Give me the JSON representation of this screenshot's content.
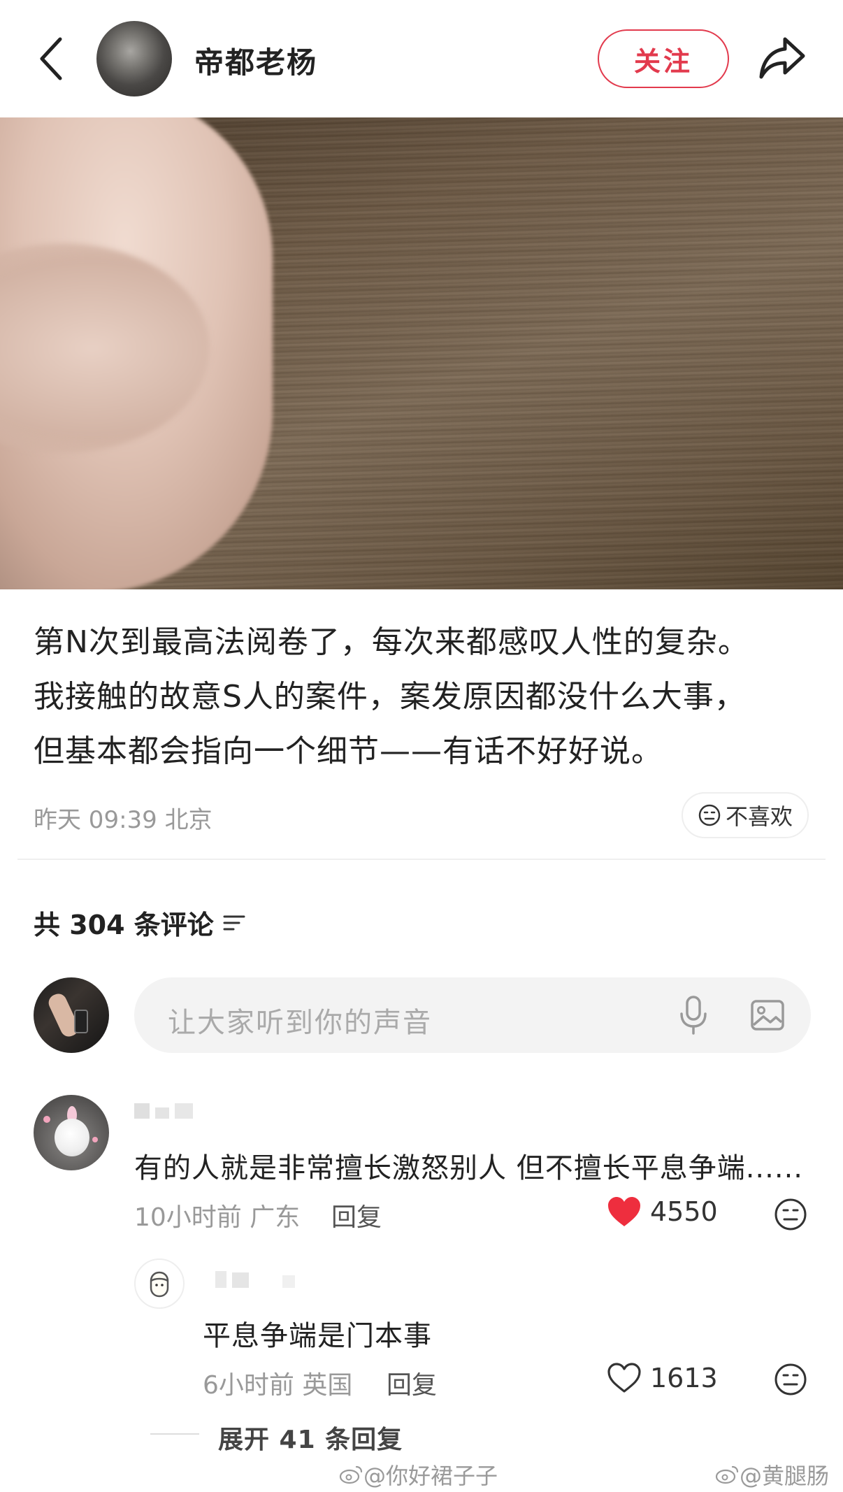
{
  "header": {
    "author_name": "帝都老杨",
    "follow_label": "关注"
  },
  "post": {
    "text_lines": [
      "第N次到最高法阅卷了，每次来都感叹人性的复杂。",
      "我接触的故意S人的案件，案发原因都没什么大事，",
      "但基本都会指向一个细节——有话不好好说。"
    ],
    "meta": "昨天 09:39 北京",
    "dislike_label": "不喜欢"
  },
  "comments_section": {
    "count_label": "共 304 条评论",
    "input_placeholder": "让大家听到你的声音"
  },
  "comments": [
    {
      "text": "有的人就是非常擅长激怒别人 但不擅长平息争端......",
      "meta": "10小时前 广东",
      "reply_label": "回复",
      "likes": "4550",
      "liked": true,
      "reply": {
        "text": "平息争端是门本事",
        "meta": "6小时前 英国",
        "reply_label": "回复",
        "likes": "1613",
        "liked": false
      },
      "expand_label": "展开 41 条回复"
    }
  ],
  "watermarks": [
    "@你好裙子子",
    "@黄腿肠"
  ],
  "colors": {
    "accent": "#e23a4d",
    "like_active": "#ee2e3e",
    "muted_text": "#999999"
  }
}
